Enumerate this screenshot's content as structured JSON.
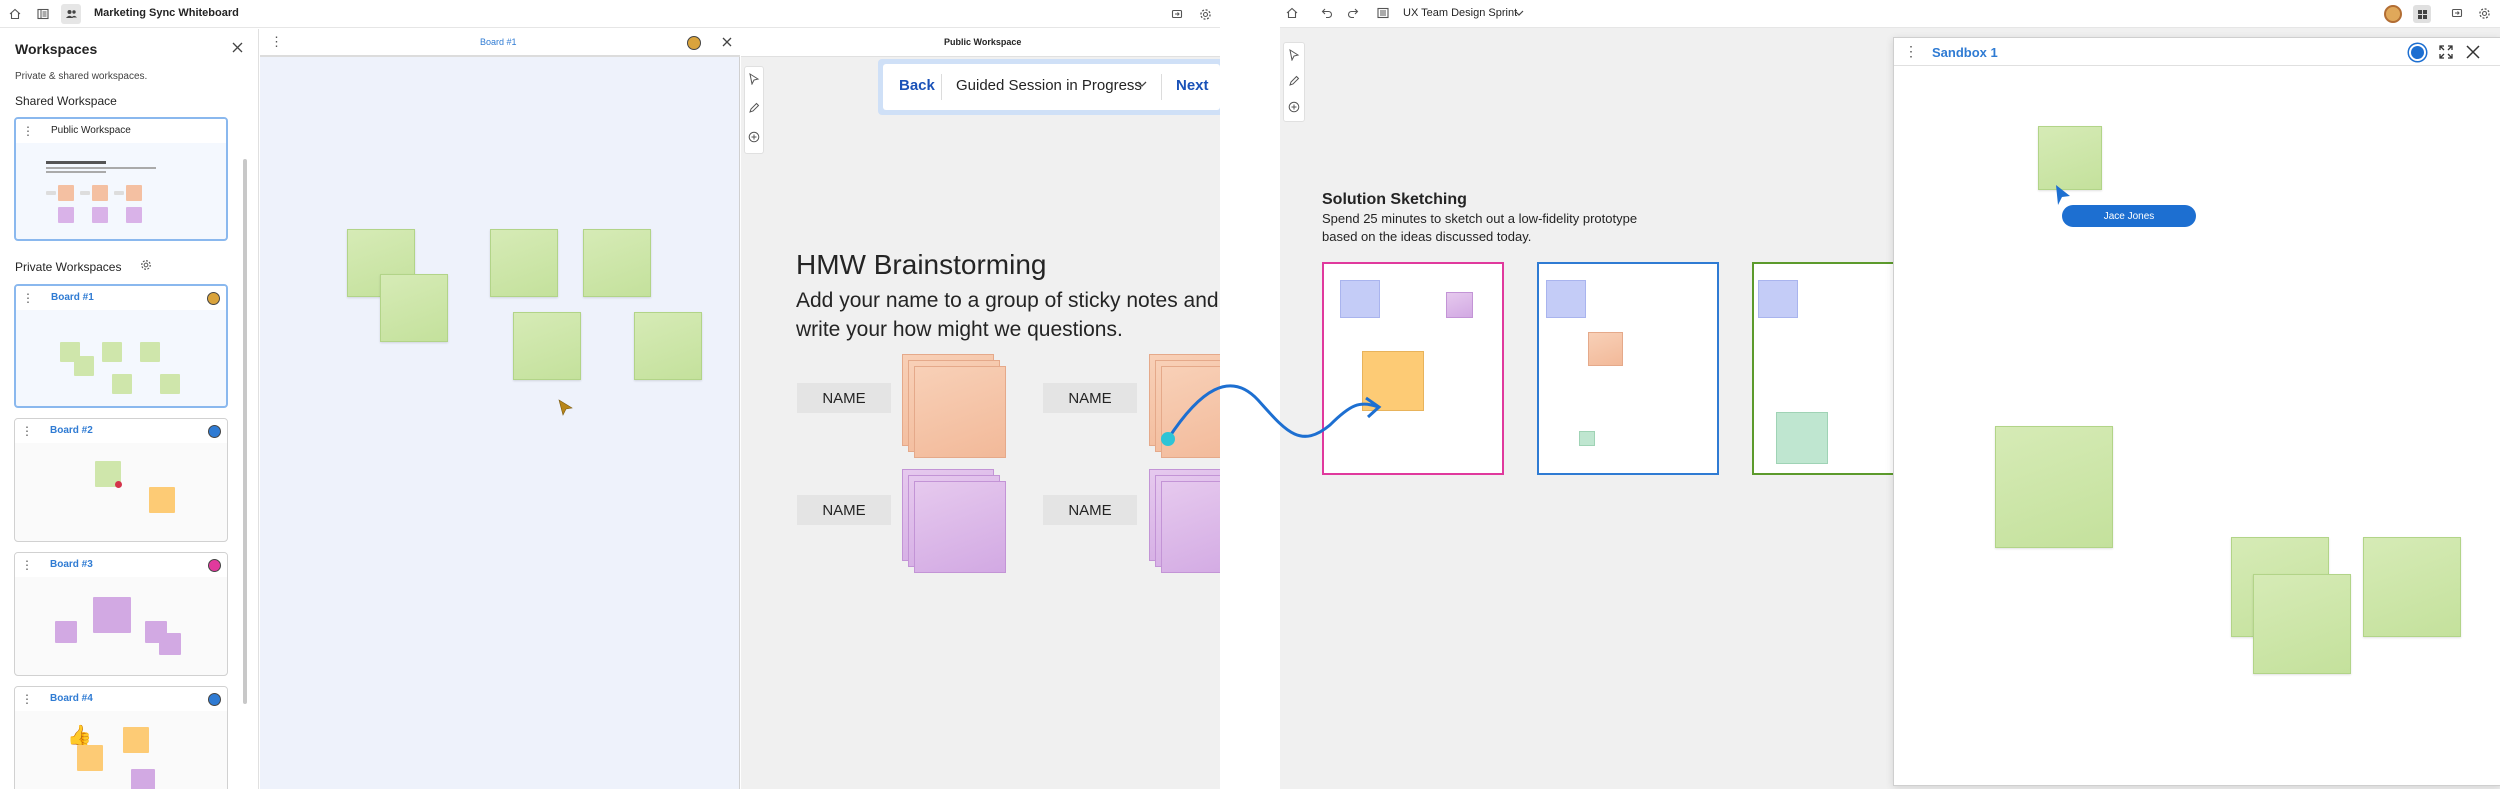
{
  "left_app": {
    "title": "Marketing Sync Whiteboard",
    "sidebar": {
      "title": "Workspaces",
      "subtitle": "Private & shared workspaces.",
      "shared_section": "Shared Workspace",
      "public_card_label": "Public Workspace",
      "private_section": "Private Workspaces",
      "boards": [
        {
          "label": "Board #1",
          "badge_color": "#d9a33c"
        },
        {
          "label": "Board #2",
          "badge_color": "#2f7bd3"
        },
        {
          "label": "Board #3",
          "badge_color": "#e0399d"
        },
        {
          "label": "Board #4",
          "badge_color": "#2f7bd3"
        }
      ]
    },
    "board_panel": {
      "title": "Board #1"
    },
    "public_panel": {
      "title": "Public Workspace",
      "guided": {
        "back": "Back",
        "status": "Guided Session in Progress",
        "next": "Next"
      },
      "heading": "HMW Brainstorming",
      "body": "Add your name to a group of sticky notes and write your how might we questions.",
      "name_labels": [
        "NAME",
        "NAME",
        "NAME",
        "NAME"
      ]
    }
  },
  "right_app": {
    "title": "UX Team Design Sprint",
    "section_title": "Solution Sketching",
    "section_desc_1": "Spend 25 minutes to sketch out a low-fidelity prototype",
    "section_desc_2": "based on the ideas discussed today.",
    "sandbox": {
      "title": "Sandbox 1",
      "cursor_name": "Jace Jones"
    }
  },
  "colors": {
    "accent_blue": "#2f7bd3",
    "link_blue": "#1a52b8",
    "frame_pink": "#e0399d",
    "frame_blue": "#2f7bd3",
    "frame_green": "#5c9a2c",
    "connector_teal": "#2ec4d6",
    "connector_blue": "#1d6fd1"
  }
}
